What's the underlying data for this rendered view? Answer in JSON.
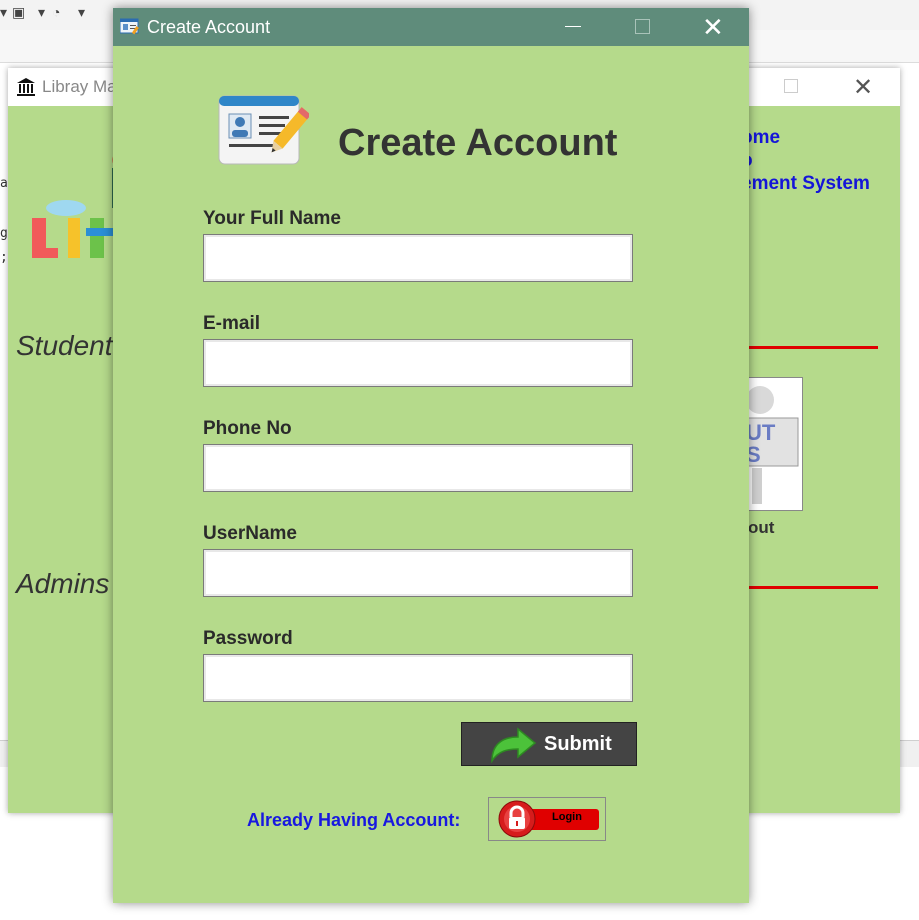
{
  "dialog": {
    "title": "Create Account",
    "heading": "Create Account",
    "fields": [
      {
        "label": "Your Full Name",
        "value": ""
      },
      {
        "label": "E-mail",
        "value": ""
      },
      {
        "label": "Phone No",
        "value": ""
      },
      {
        "label": "UserName",
        "value": ""
      },
      {
        "label": "Password",
        "value": ""
      }
    ],
    "submit_label": "Submit",
    "already_text": "Already Having Account:",
    "login_label": "Login"
  },
  "background_window": {
    "title": "Libray Ma",
    "welcome_text": "ome\no\nement System",
    "student_heading": "Student",
    "admin_heading": "Admins",
    "about_label": "out",
    "about_text": "UT\nS"
  },
  "colors": {
    "form_bg": "#b5da8b",
    "dialog_titlebar": "#5f8c7b",
    "link_blue": "#1818e0",
    "separator_red": "#e00000",
    "submit_bg": "#444444"
  },
  "icons": [
    "app-icon",
    "id-card-icon",
    "green-arrow-icon",
    "lock-icon",
    "library-icon"
  ]
}
